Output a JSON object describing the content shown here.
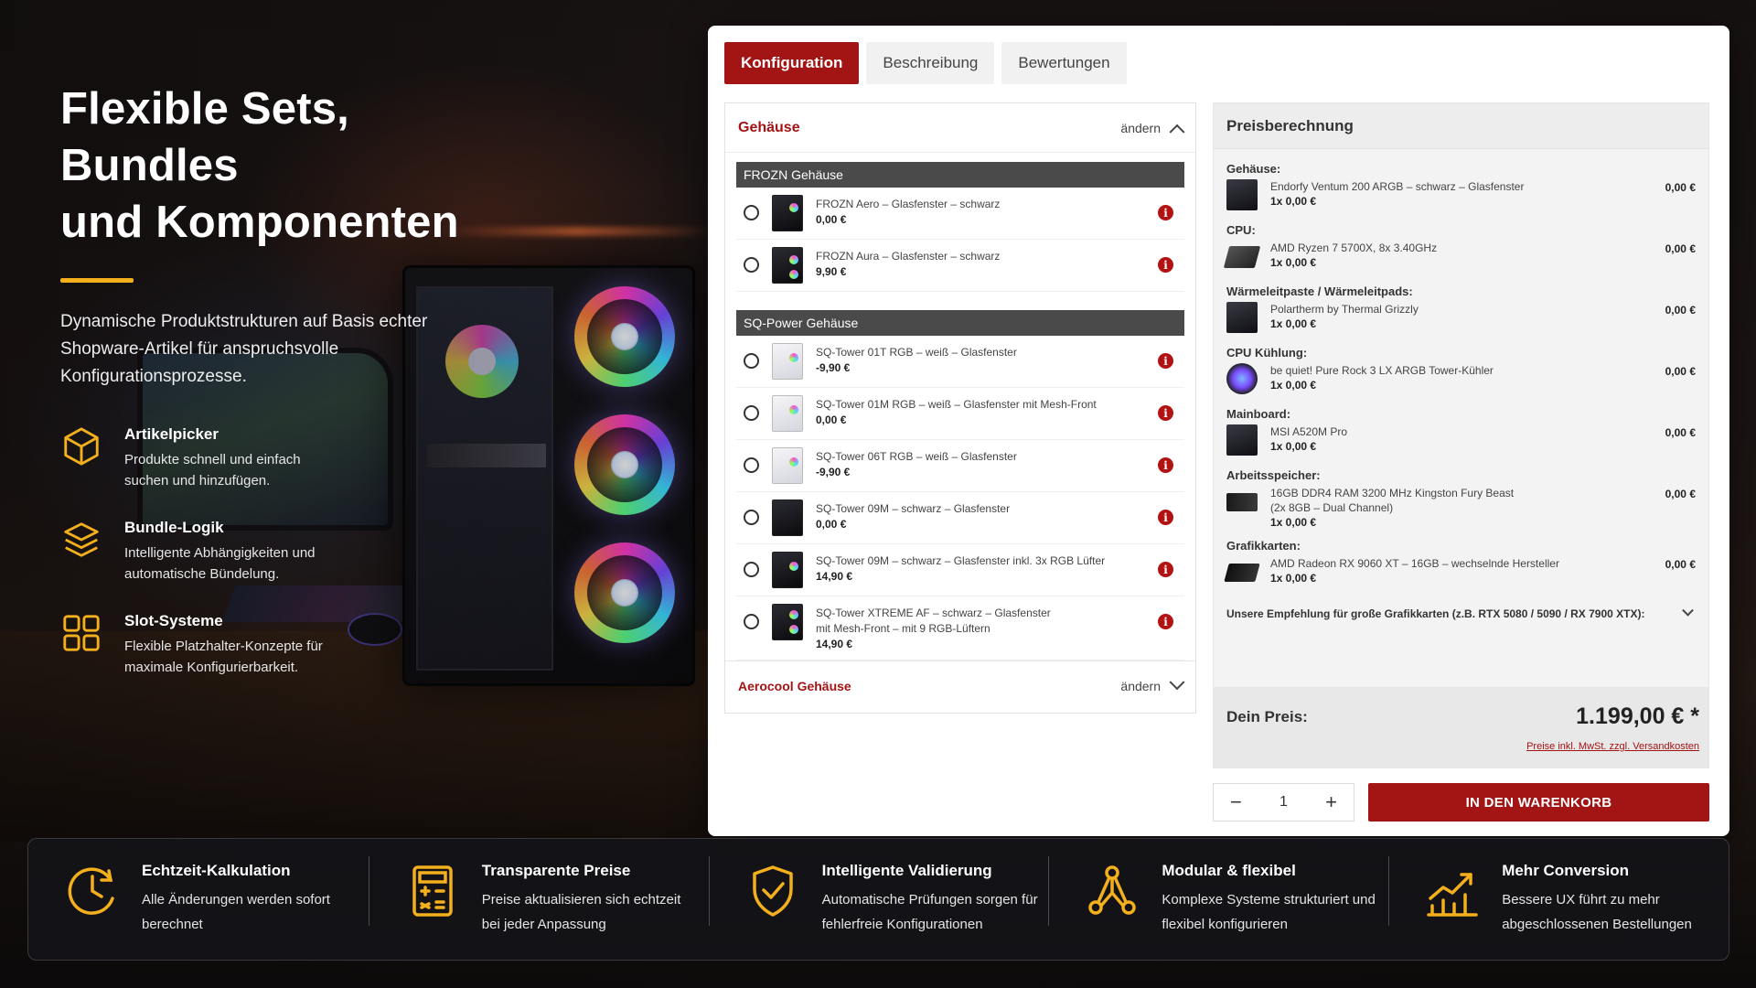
{
  "hero": {
    "title": "Flexible Sets, Bundles\nund Komponenten",
    "intro": "Dynamische Produktstrukturen auf Basis echter Shopware-Artikel für anspruchsvolle Konfigurationsprozesse.",
    "features": [
      {
        "icon": "cube-icon",
        "title": "Artikelpicker",
        "desc": "Produkte schnell und einfach suchen und hinzufügen."
      },
      {
        "icon": "layers-icon",
        "title": "Bundle-Logik",
        "desc": "Intelligente Abhängigkeiten und automatische Bündelung."
      },
      {
        "icon": "grid-icon",
        "title": "Slot-Systeme",
        "desc": "Flexible Platzhalter-Konzepte für maximale Konfigurierbarkeit."
      }
    ]
  },
  "tabs": [
    "Konfiguration",
    "Beschreibung",
    "Bewertungen"
  ],
  "config": {
    "section_title": "Gehäuse",
    "change_label": "ändern",
    "groups": [
      {
        "name": "FROZN Gehäuse",
        "options": [
          {
            "name": "FROZN Aero – Glasfenster – schwarz",
            "price": "0,00 €",
            "thumb": "dark"
          },
          {
            "name": "FROZN Aura – Glasfenster – schwarz",
            "price": "9,90 €",
            "thumb": "dark"
          }
        ]
      },
      {
        "name": "SQ-Power Gehäuse",
        "options": [
          {
            "name": "SQ-Tower 01T RGB – weiß – Glasfenster",
            "price": "-9,90 €",
            "thumb": "white"
          },
          {
            "name": "SQ-Tower 01M RGB – weiß – Glasfenster mit Mesh-Front",
            "price": "0,00 €",
            "thumb": "white"
          },
          {
            "name": "SQ-Tower 06T RGB – weiß – Glasfenster",
            "price": "-9,90 €",
            "thumb": "white"
          },
          {
            "name": "SQ-Tower 09M – schwarz – Glasfenster",
            "price": "0,00 €",
            "thumb": "dark"
          },
          {
            "name": "SQ-Tower 09M – schwarz – Glasfenster inkl. 3x RGB Lüfter",
            "price": "14,90 €",
            "thumb": "dark"
          },
          {
            "name": "SQ-Tower XTREME AF – schwarz – Glasfenster\nmit Mesh-Front – mit 9 RGB-Lüftern",
            "price": "14,90 €",
            "thumb": "dark"
          }
        ]
      }
    ],
    "collapsed_section_title": "Aerocool Gehäuse",
    "collapsed_change_label": "ändern"
  },
  "price": {
    "title": "Preisberechnung",
    "items": [
      {
        "category": "Gehäuse:",
        "name": "Endorfy Ventum 200 ARGB – schwarz – Glasfenster",
        "qty": "1x 0,00 €",
        "value": "0,00 €",
        "thumb": "case"
      },
      {
        "category": "CPU:",
        "name": "AMD Ryzen 7 5700X, 8x 3.40GHz",
        "qty": "1x 0,00 €",
        "value": "0,00 €",
        "thumb": "cpu"
      },
      {
        "category": "Wärmeleitpaste / Wärmeleitpads:",
        "name": "Polartherm by Thermal Grizzly",
        "qty": "1x 0,00 €",
        "value": "0,00 €",
        "thumb": "paste"
      },
      {
        "category": "CPU Kühlung:",
        "name": "be quiet! Pure Rock 3 LX ARGB Tower-Kühler",
        "qty": "1x 0,00 €",
        "value": "0,00 €",
        "thumb": "cooler"
      },
      {
        "category": "Mainboard:",
        "name": "MSI A520M Pro",
        "qty": "1x 0,00 €",
        "value": "0,00 €",
        "thumb": "board"
      },
      {
        "category": "Arbeitsspeicher:",
        "name": "16GB DDR4 RAM 3200 MHz Kingston Fury Beast\n(2x 8GB – Dual Channel)",
        "qty": "1x 0,00 €",
        "value": "0,00 €",
        "thumb": "ram"
      },
      {
        "category": "Grafikkarten:",
        "name": "AMD Radeon RX 9060 XT – 16GB – wechselnde Hersteller",
        "qty": "1x 0,00 €",
        "value": "0,00 €",
        "thumb": "gpu"
      }
    ],
    "recommendation": "Unsere Empfehlung für große Grafikkarten (z.B. RTX 5080 / 5090 / RX 7900 XTX):",
    "total_label": "Dein Preis:",
    "total_value": "1.199,00 € *",
    "total_note": "Preise inkl. MwSt. zzgl. Versandkosten"
  },
  "cart": {
    "minus": "−",
    "quantity": "1",
    "plus": "+",
    "button_label": "IN DEN WARENKORB"
  },
  "strip": [
    {
      "icon": "clock-icon",
      "title": "Echtzeit-Kalkulation",
      "desc": "Alle Änderungen werden sofort berechnet"
    },
    {
      "icon": "calculator-icon",
      "title": "Transparente Preise",
      "desc": "Preise aktualisieren sich echtzeit bei jeder Anpassung"
    },
    {
      "icon": "shield-check-icon",
      "title": "Intelligente Validierung",
      "desc": "Automatische Prüfungen sorgen für fehlerfreie Konfigurationen"
    },
    {
      "icon": "nodes-icon",
      "title": "Modular & flexibel",
      "desc": "Komplexe Systeme strukturiert und flexibel konfigurieren"
    },
    {
      "icon": "growth-chart-icon",
      "title": "Mehr Conversion",
      "desc": "Bessere UX führt zu mehr abgeschlossenen Bestellungen"
    }
  ],
  "colors": {
    "accent": "#a31414",
    "gold": "#f3b01c"
  }
}
